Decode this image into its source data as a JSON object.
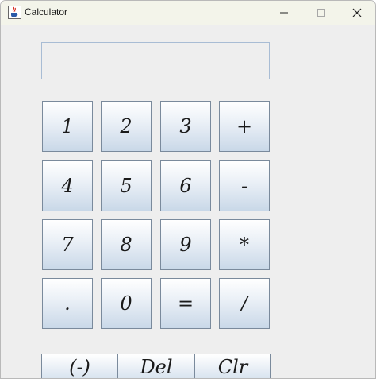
{
  "window": {
    "title": "Calculator",
    "icon": "java-cup-icon"
  },
  "display": {
    "value": ""
  },
  "keypad": {
    "row1": [
      "1",
      "2",
      "3",
      "+"
    ],
    "row2": [
      "4",
      "5",
      "6",
      "-"
    ],
    "row3": [
      "7",
      "8",
      "9",
      "*"
    ],
    "row4": [
      ".",
      "0",
      "=",
      "/"
    ]
  },
  "actions": {
    "negate": "(-)",
    "delete": "Del",
    "clear": "Clr"
  },
  "colors": {
    "titlebar": "#f3f4ea",
    "content_bg": "#eeeeee",
    "button_top": "#ffffff",
    "button_bottom": "#c9d8e8",
    "border": "#7a8a9c"
  }
}
